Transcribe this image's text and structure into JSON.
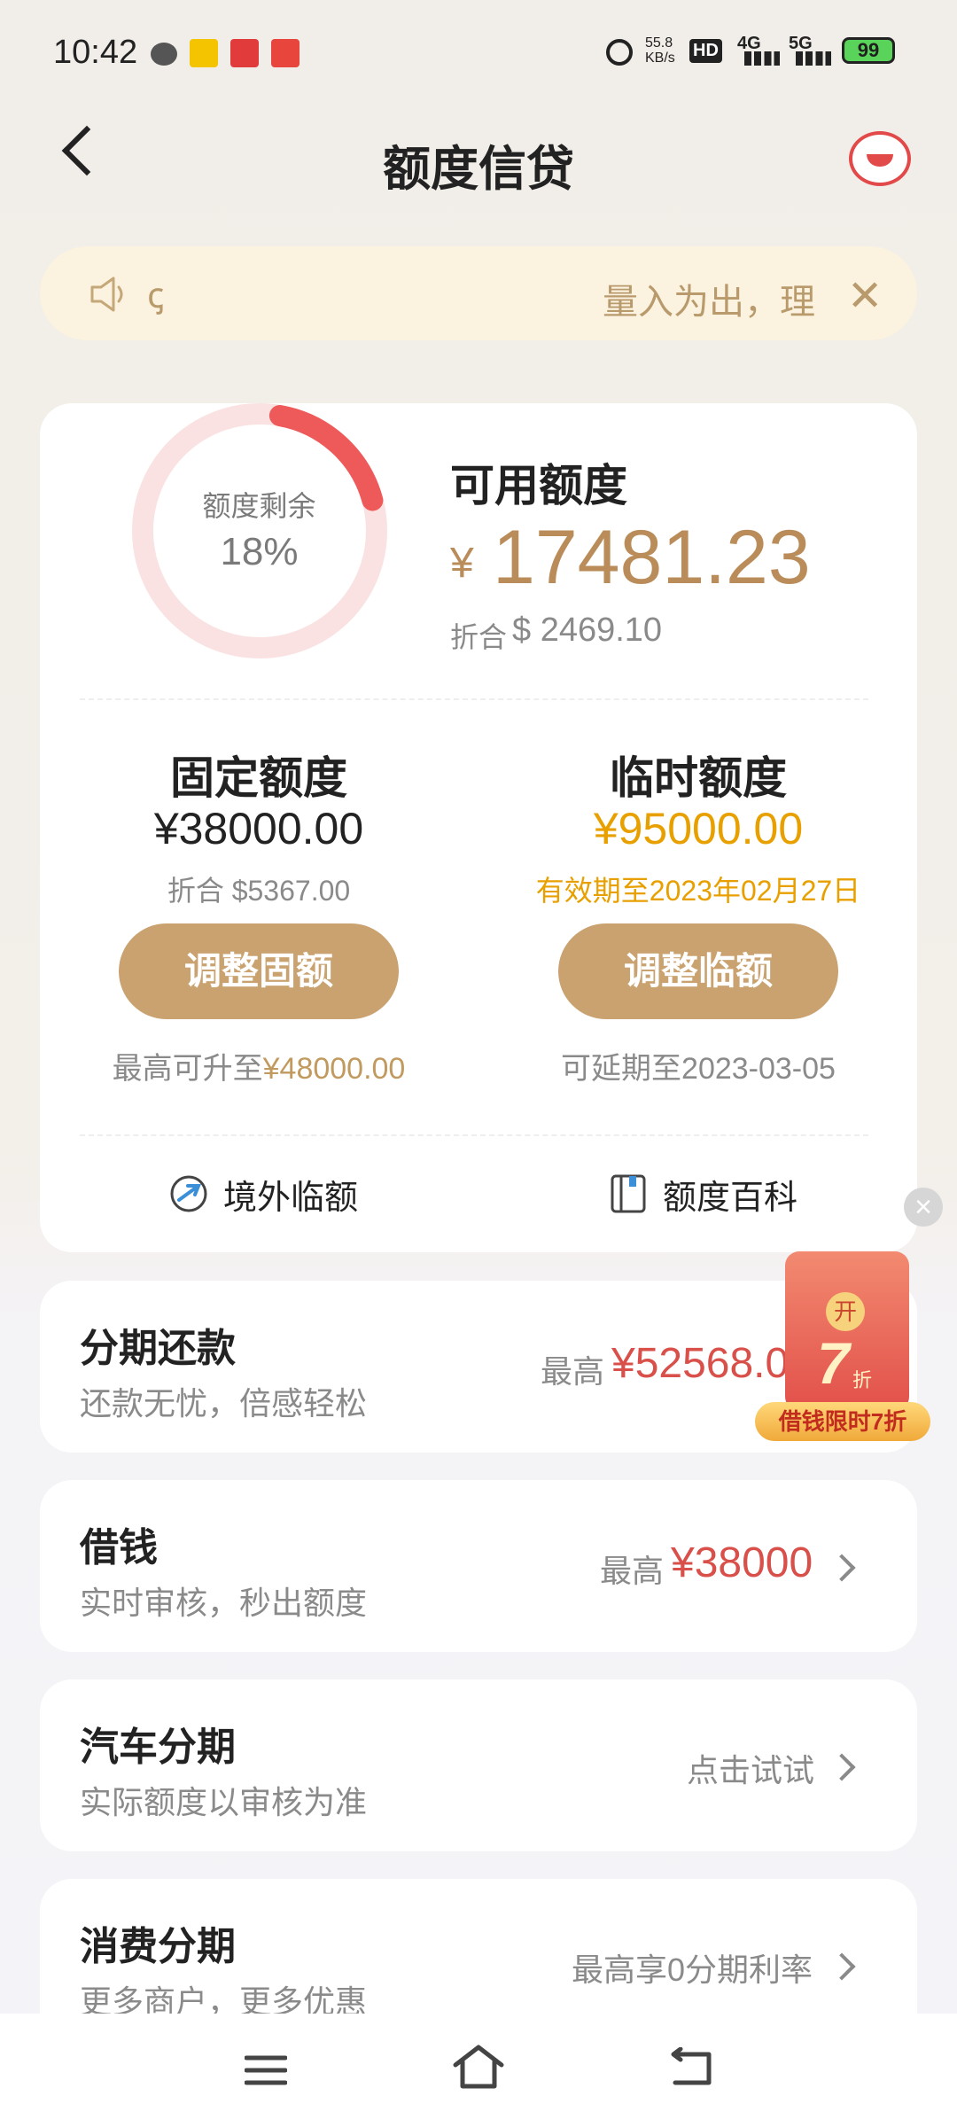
{
  "status_bar": {
    "time": "10:42",
    "net_speed": "55.8",
    "net_unit": "KB/s",
    "hd": "HD",
    "sig4g": "4G",
    "sig5g": "5G",
    "battery": "99"
  },
  "header": {
    "title": "额度信贷"
  },
  "notice": {
    "left_text": "ꞔ",
    "text": "量入为出，理"
  },
  "credit": {
    "ring_label": "额度剩余",
    "ring_percent_text": "18%",
    "ring_fraction": 0.18,
    "available_label": "可用额度",
    "available_currency": "¥",
    "available_amount": "17481.23",
    "approx_label": "折合",
    "approx_value": "$ 2469.10"
  },
  "fixed": {
    "title": "固定额度",
    "amount": "¥38000.00",
    "sub": "折合 $5367.00",
    "button": "调整固额",
    "note_prefix": "最高可升至",
    "note_value": "¥48000.00"
  },
  "temp": {
    "title": "临时额度",
    "amount": "¥95000.00",
    "sub": "有效期至2023年02月27日",
    "button": "调整临额",
    "note": "可延期至2023-03-05"
  },
  "quick_links": [
    {
      "label": "境外临额",
      "icon": "plane-icon"
    },
    {
      "label": "额度百科",
      "icon": "book-icon"
    }
  ],
  "list": [
    {
      "title": "分期还款",
      "subtitle": "还款无忧，倍感轻松",
      "right_prefix": "最高",
      "right_value": "¥52568.0"
    },
    {
      "title": "借钱",
      "subtitle": "实时审核，秒出额度",
      "right_prefix": "最高",
      "right_value": "¥38000"
    },
    {
      "title": "汽车分期",
      "subtitle": "实际额度以审核为准",
      "right_text": "点击试试"
    },
    {
      "title": "消费分期",
      "subtitle": "更多商户，更多优惠",
      "right_text": "最高享0分期利率"
    }
  ],
  "promo": {
    "open_label": "开",
    "number": "7",
    "unit": "折",
    "banner": "借钱限时7折"
  },
  "colors": {
    "gold": "#c9a26f",
    "ring_accent": "#ee5a5a",
    "red": "#d9504a",
    "yellow": "#e8a000"
  }
}
